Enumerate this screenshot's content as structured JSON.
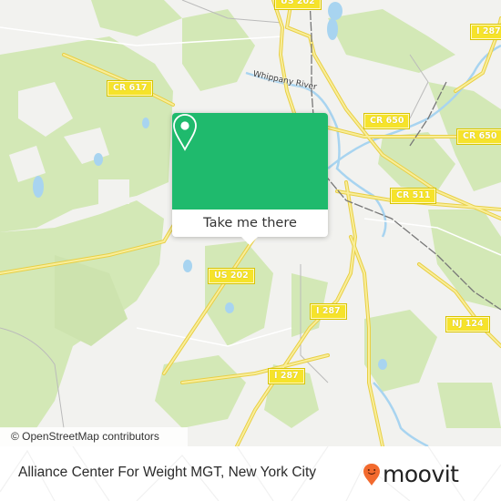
{
  "map": {
    "road_labels": [
      {
        "id": "us202-top",
        "text": "US 202"
      },
      {
        "id": "i287-top",
        "text": "I 287"
      },
      {
        "id": "cr617",
        "text": "CR 617"
      },
      {
        "id": "cr650-a",
        "text": "CR 650"
      },
      {
        "id": "cr650-b",
        "text": "CR 650"
      },
      {
        "id": "cr511",
        "text": "CR 511"
      },
      {
        "id": "us202",
        "text": "US 202"
      },
      {
        "id": "i287-mid",
        "text": "I 287"
      },
      {
        "id": "nj124",
        "text": "NJ 124"
      },
      {
        "id": "i287-low",
        "text": "I 287"
      }
    ],
    "water_labels": [
      {
        "text": "Whippany River"
      }
    ],
    "attribution": "© OpenStreetMap contributors",
    "colors": {
      "background": "#f2f2ef",
      "park": "#cfe6b0",
      "water": "#a8d4f0",
      "road": "#f6e06a",
      "rail": "#777777"
    }
  },
  "popup": {
    "icon": "map-pin-icon",
    "button_label": "Take me there",
    "accent_color": "#1fba6d"
  },
  "footer": {
    "place_name": "Alliance Center For Weight MGT, New York City",
    "logo_text": "moovit",
    "logo_icon": "moovit-pin-icon",
    "logo_color": "#f26a2e"
  }
}
